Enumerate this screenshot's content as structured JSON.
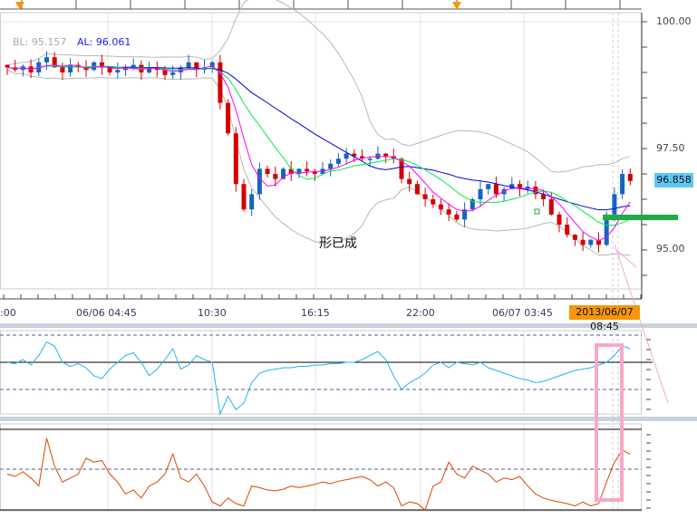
{
  "legend": {
    "bl": "BL: 95.157",
    "al": "AL: 96.061"
  },
  "price_axis": [
    "100.00",
    "97.50",
    "95.00"
  ],
  "current_price": "96.858",
  "current_time": "2013/06/07 08:45",
  "time_axis": [
    ":00",
    "06/06 04:45",
    "10:30",
    "16:15",
    "22:00",
    "06/07 03:45"
  ],
  "annotation": "形已成",
  "colors": {
    "up": "#1565c0",
    "down": "#d50000",
    "ma_fast": "#ff00ff",
    "ma_mid": "#00ee44",
    "ma_slow": "#0000dd",
    "bands": "#b8b8b8",
    "osc1": "#22b5f0",
    "osc2": "#dd4400",
    "highlight": "#f7a8c8",
    "support": "#22aa44"
  },
  "closes": [
    99.1,
    99.05,
    99.12,
    99.0,
    99.2,
    99.3,
    99.1,
    99.0,
    99.15,
    99.1,
    99.05,
    99.2,
    99.1,
    99.0,
    99.05,
    99.1,
    99.15,
    99.0,
    99.1,
    99.05,
    98.95,
    99.0,
    99.1,
    99.2,
    99.05,
    99.1,
    99.2,
    98.4,
    97.8,
    96.8,
    96.3,
    96.6,
    97.1,
    97.0,
    96.9,
    97.1,
    97.0,
    97.1,
    97.05,
    97.0,
    97.1,
    97.2,
    97.3,
    97.4,
    97.35,
    97.3,
    97.3,
    97.4,
    97.35,
    97.3,
    96.9,
    96.8,
    96.6,
    96.5,
    96.4,
    96.3,
    96.2,
    96.1,
    96.3,
    96.5,
    96.7,
    96.8,
    96.6,
    96.7,
    96.8,
    96.7,
    96.75,
    96.6,
    96.5,
    96.2,
    96.0,
    95.8,
    95.7,
    95.6,
    95.7,
    95.6,
    96.2,
    96.6,
    97.0,
    96.86
  ],
  "osc1": [
    50,
    49,
    52,
    48,
    55,
    65,
    62,
    50,
    47,
    49,
    46,
    40,
    38,
    45,
    50,
    55,
    57,
    50,
    40,
    45,
    52,
    60,
    45,
    48,
    55,
    52,
    50,
    12,
    25,
    15,
    20,
    35,
    42,
    44,
    45,
    46,
    46,
    47,
    47,
    48,
    48,
    49,
    49,
    50,
    50,
    52,
    55,
    58,
    52,
    40,
    30,
    35,
    38,
    42,
    48,
    50,
    46,
    50,
    49,
    48,
    50,
    46,
    44,
    42,
    40,
    38,
    37,
    35,
    36,
    38,
    40,
    42,
    44,
    45,
    46,
    48,
    50,
    55,
    62,
    60
  ],
  "osc2": [
    45,
    42,
    48,
    40,
    30,
    90,
    55,
    35,
    40,
    45,
    65,
    60,
    62,
    45,
    35,
    20,
    25,
    15,
    30,
    35,
    45,
    70,
    40,
    35,
    45,
    30,
    10,
    5,
    15,
    8,
    5,
    30,
    28,
    25,
    24,
    26,
    30,
    28,
    30,
    32,
    35,
    33,
    36,
    38,
    40,
    42,
    38,
    30,
    35,
    28,
    5,
    10,
    8,
    0,
    30,
    35,
    60,
    45,
    40,
    55,
    50,
    45,
    35,
    40,
    38,
    42,
    30,
    20,
    15,
    12,
    10,
    8,
    5,
    10,
    5,
    8,
    35,
    60,
    75,
    70
  ]
}
